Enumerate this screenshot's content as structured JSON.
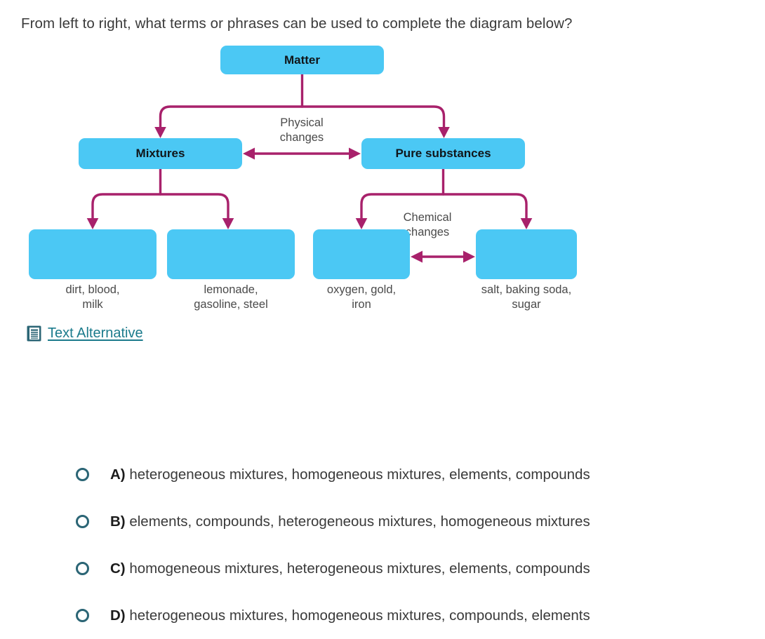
{
  "question": {
    "prompt": "From left to right, what terms or phrases can be used to complete the diagram below?"
  },
  "diagram": {
    "nodes": {
      "root": "Matter",
      "left": "Mixtures",
      "right": "Pure substances"
    },
    "edge_labels": {
      "physical": "Physical\nchanges",
      "physical_line1": "Physical",
      "physical_line2": "changes",
      "chemical_line1": "Chemical",
      "chemical_line2": "changes"
    },
    "leaf_boxes": [
      {
        "label": "",
        "caption": "dirt, blood,\nmilk",
        "caption_line1": "dirt, blood,",
        "caption_line2": "milk"
      },
      {
        "label": "",
        "caption": "lemonade,\ngasoline, steel",
        "caption_line1": "lemonade,",
        "caption_line2": "gasoline, steel"
      },
      {
        "label": "",
        "caption": "oxygen, gold,\niron",
        "caption_line1": "oxygen, gold,",
        "caption_line2": "iron"
      },
      {
        "label": "",
        "caption": "salt, baking soda,\nsugar",
        "caption_line1": "salt, baking soda,",
        "caption_line2": "sugar"
      }
    ],
    "colors": {
      "box_fill": "#4bc8f4",
      "connector": "#a8216b",
      "box_text": "#10161a",
      "caption_text": "#4a4a4a"
    }
  },
  "text_alternative": {
    "label": "Text Alternative",
    "icon": "document-icon",
    "color": "#1b7b8c"
  },
  "answers": {
    "options": [
      {
        "letter": "A)",
        "text": "heterogeneous mixtures, homogeneous mixtures, elements, compounds",
        "selected": false
      },
      {
        "letter": "B)",
        "text": "elements, compounds, heterogeneous mixtures, homogeneous mixtures",
        "selected": false
      },
      {
        "letter": "C)",
        "text": "homogeneous mixtures, heterogeneous mixtures, elements, compounds",
        "selected": false
      },
      {
        "letter": "D)",
        "text": "heterogeneous mixtures, homogeneous mixtures, compounds, elements",
        "selected": false
      }
    ],
    "radio_color": "#2b6575"
  }
}
